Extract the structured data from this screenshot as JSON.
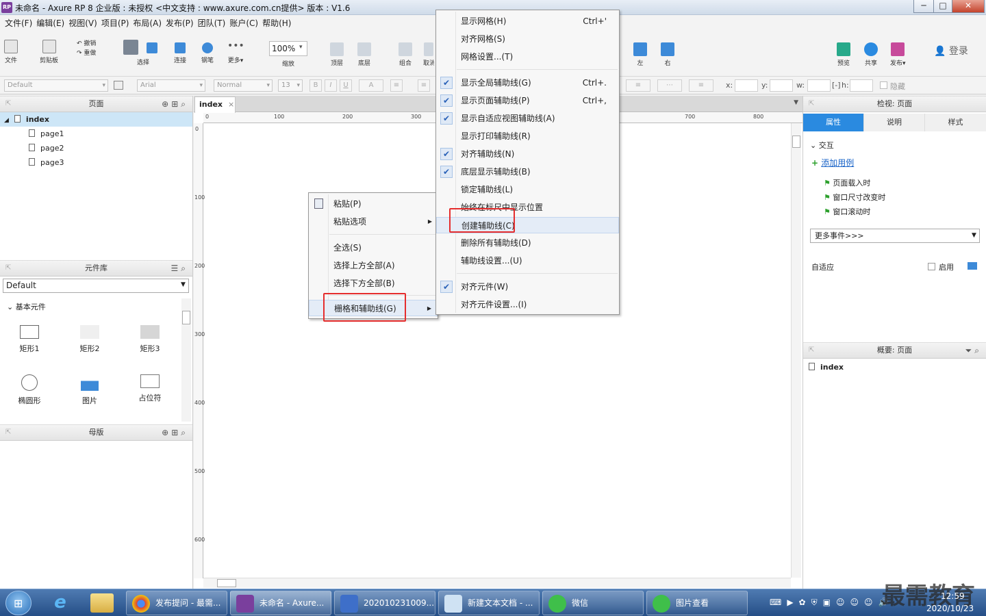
{
  "window": {
    "title": "未命名 - Axure RP 8 企业版 : 未授权      <中文支持 : www.axure.com.cn提供> 版本 : V1.6",
    "logo": "RP",
    "controls": {
      "minimize": "─",
      "maximize": "□",
      "close": "✕"
    }
  },
  "menubar": [
    "文件(F)",
    "编辑(E)",
    "视图(V)",
    "项目(P)",
    "布局(A)",
    "发布(P)",
    "团队(T)",
    "账户(C)",
    "帮助(H)"
  ],
  "toolbar": {
    "file": "文件",
    "clipboard": "剪贴板",
    "undo": "撤销",
    "redo": "重做",
    "select": "选择",
    "connect": "连接",
    "pen": "钢笔",
    "more": "更多▾",
    "zoom_value": "100%",
    "zoom": "缩放",
    "top": "顶层",
    "bottom": "底层",
    "group": "组合",
    "ungroup": "取消",
    "left": "左",
    "right": "右",
    "preview": "预览",
    "share": "共享",
    "publish": "发布▾",
    "login": "登录"
  },
  "formatbar": {
    "style": "Default",
    "font": "Arial",
    "weight": "Normal",
    "size": "13",
    "bold": "B",
    "italic": "I",
    "underline": "U",
    "fontcolor": "A",
    "x": "x:",
    "y": "y:",
    "w": "w:",
    "h": "h:",
    "hide": "隐藏"
  },
  "pages": {
    "header": "页面",
    "root": "index",
    "children": [
      "page1",
      "page2",
      "page3"
    ]
  },
  "library": {
    "header": "元件库",
    "selected": "Default",
    "category": "基本元件",
    "widgets": [
      "矩形1",
      "矩形2",
      "矩形3",
      "椭圆形",
      "图片",
      "占位符"
    ]
  },
  "masters": {
    "header": "母版"
  },
  "canvas": {
    "tab": "index",
    "tab_close": "×",
    "hticks": [
      "0",
      "100",
      "200",
      "300",
      "700",
      "800"
    ],
    "vticks": [
      "0",
      "100",
      "200",
      "300",
      "400",
      "500",
      "600"
    ]
  },
  "context_menu": {
    "items": [
      "粘贴(P)",
      "粘贴选项",
      "全选(S)",
      "选择上方全部(A)",
      "选择下方全部(B)",
      "栅格和辅助线(G)"
    ]
  },
  "submenu": {
    "items": [
      {
        "label": "显示网格(H)",
        "shortcut": "Ctrl+'",
        "checked": false
      },
      {
        "label": "对齐网格(S)",
        "shortcut": "",
        "checked": false
      },
      {
        "label": "网格设置...(T)",
        "shortcut": "",
        "checked": false
      },
      {
        "label": "显示全局辅助线(G)",
        "shortcut": "Ctrl+.",
        "checked": true
      },
      {
        "label": "显示页面辅助线(P)",
        "shortcut": "Ctrl+,",
        "checked": true
      },
      {
        "label": "显示自适应视图辅助线(A)",
        "shortcut": "",
        "checked": true
      },
      {
        "label": "显示打印辅助线(R)",
        "shortcut": "",
        "checked": false
      },
      {
        "label": "对齐辅助线(N)",
        "shortcut": "",
        "checked": true
      },
      {
        "label": "底层显示辅助线(B)",
        "shortcut": "",
        "checked": true
      },
      {
        "label": "锁定辅助线(L)",
        "shortcut": "",
        "checked": false
      },
      {
        "label": "始终在标尺中显示位置",
        "shortcut": "",
        "checked": false
      },
      {
        "label": "创建辅助线(C)",
        "shortcut": "",
        "checked": false
      },
      {
        "label": "删除所有辅助线(D)",
        "shortcut": "",
        "checked": false
      },
      {
        "label": "辅助线设置...(U)",
        "shortcut": "",
        "checked": false
      },
      {
        "label": "对齐元件(W)",
        "shortcut": "",
        "checked": true
      },
      {
        "label": "对齐元件设置...(I)",
        "shortcut": "",
        "checked": false
      }
    ]
  },
  "inspector": {
    "header": "检视: 页面",
    "tabs": [
      "属性",
      "说明",
      "样式"
    ],
    "interaction": "交互",
    "add_case": "添加用例",
    "events": [
      "页面载入时",
      "窗口尺寸改变时",
      "窗口滚动时"
    ],
    "more_events": "更多事件>>>",
    "adaptive": "自适应",
    "enable": "启用"
  },
  "outline": {
    "header": "概要: 页面",
    "item": "index"
  },
  "taskbar": {
    "apps": [
      "发布提问 - 最需...",
      "未命名 - Axure...",
      "202010231009...",
      "新建文本文档 - ...",
      "微信",
      "图片查看"
    ],
    "time": "12:59",
    "date": "2020/10/23",
    "watermark": "最需教育"
  },
  "colors": {
    "accent": "#2a8ae0",
    "highlight": "#e52d2d",
    "taskbar": "#2d5a94"
  }
}
